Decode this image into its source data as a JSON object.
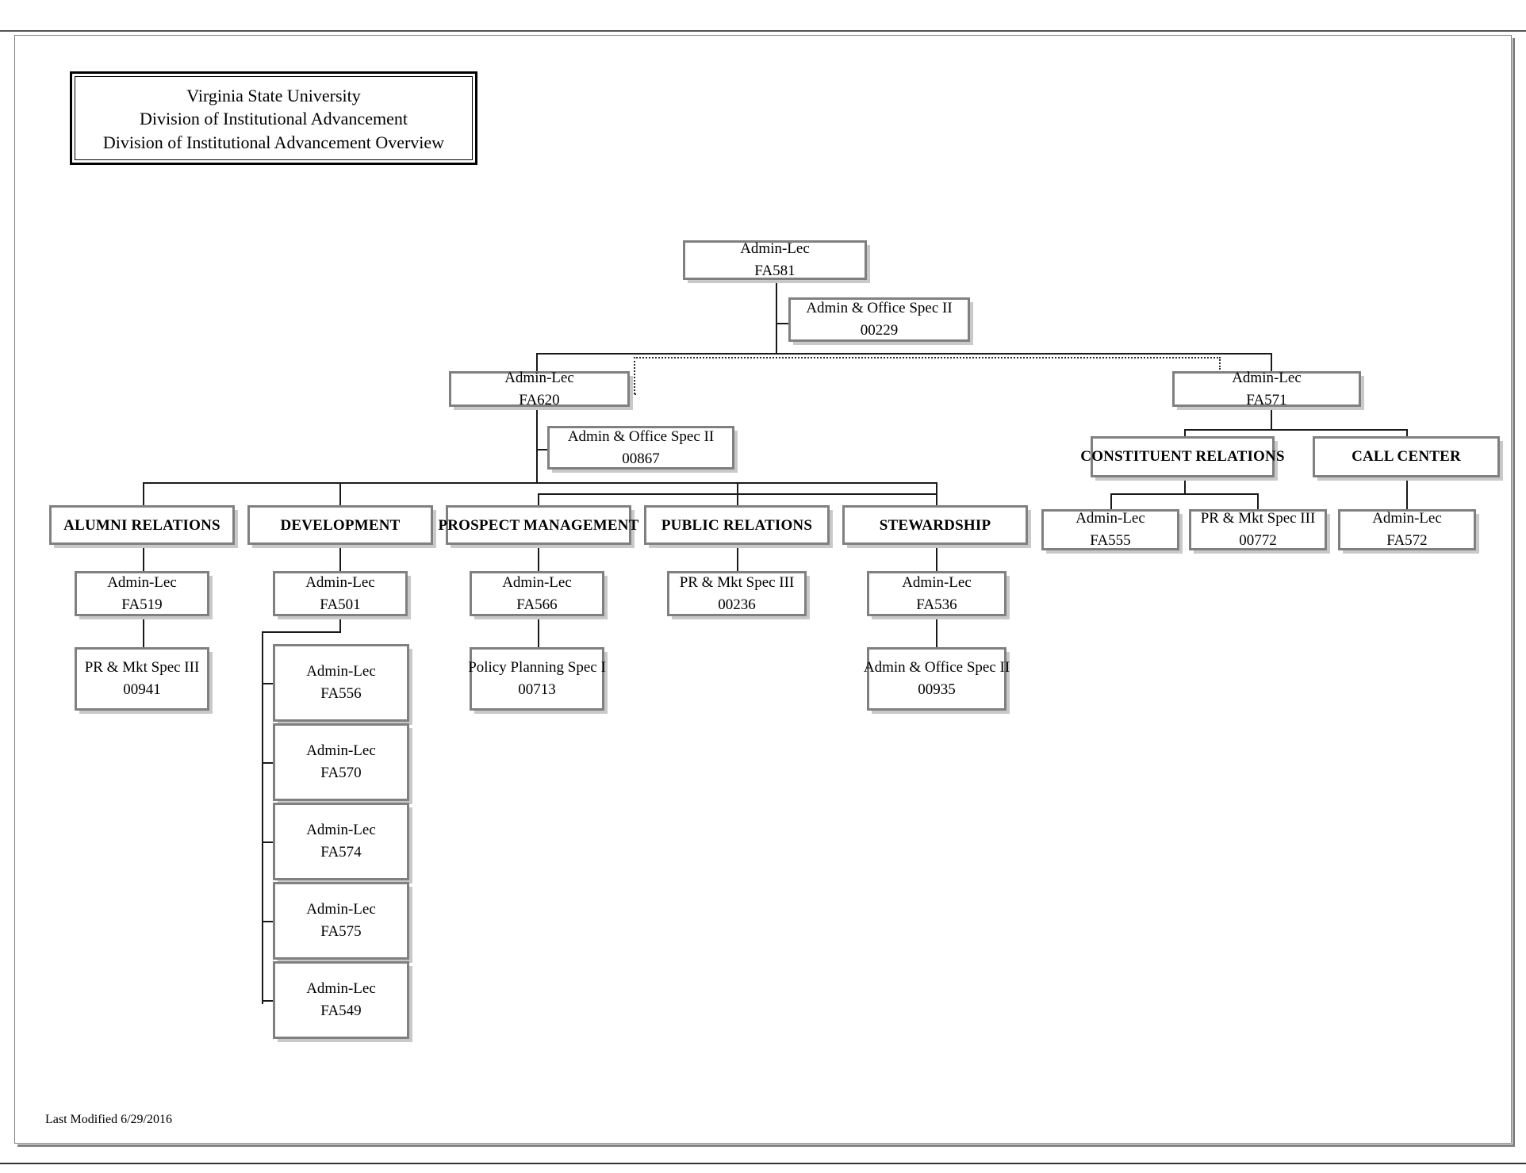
{
  "document": {
    "title_lines": [
      "Virginia State University",
      "Division of Institutional Advancement",
      "Division of Institutional Advancement Overview"
    ],
    "footer": "Last Modified  6/29/2016"
  },
  "chart_data": {
    "type": "diagram",
    "title": "Division of Institutional Advancement Overview",
    "nodes": [
      {
        "id": "n1",
        "role": "Admin-Lec",
        "code": "FA581"
      },
      {
        "id": "n2",
        "role": "Admin & Office Spec II",
        "code": "00229"
      },
      {
        "id": "n3",
        "role": "Admin-Lec",
        "code": "FA620"
      },
      {
        "id": "n4",
        "role": "Admin & Office Spec II",
        "code": "00867"
      },
      {
        "id": "n5",
        "role": "Admin-Lec",
        "code": "FA571"
      },
      {
        "id": "d1",
        "dept": "CONSTITUENT RELATIONS"
      },
      {
        "id": "d2",
        "dept": "CALL CENTER"
      },
      {
        "id": "d3",
        "dept": "ALUMNI RELATIONS"
      },
      {
        "id": "d4",
        "dept": "DEVELOPMENT"
      },
      {
        "id": "d5",
        "dept": "PROSPECT MANAGEMENT"
      },
      {
        "id": "d6",
        "dept": "PUBLIC RELATIONS"
      },
      {
        "id": "d7",
        "dept": "STEWARDSHIP"
      },
      {
        "id": "n6",
        "role": "Admin-Lec",
        "code": "FA555"
      },
      {
        "id": "n7",
        "role": "PR & Mkt Spec III",
        "code": "00772"
      },
      {
        "id": "n8",
        "role": "Admin-Lec",
        "code": "FA572"
      },
      {
        "id": "n9",
        "role": "Admin-Lec",
        "code": "FA519"
      },
      {
        "id": "n10",
        "role": "PR & Mkt Spec III",
        "code": "00941"
      },
      {
        "id": "n11",
        "role": "Admin-Lec",
        "code": "FA501"
      },
      {
        "id": "n12",
        "role": "Admin-Lec",
        "code": "FA556"
      },
      {
        "id": "n13",
        "role": "Admin-Lec",
        "code": "FA570"
      },
      {
        "id": "n14",
        "role": "Admin-Lec",
        "code": "FA574"
      },
      {
        "id": "n15",
        "role": "Admin-Lec",
        "code": "FA575"
      },
      {
        "id": "n16",
        "role": "Admin-Lec",
        "code": "FA549"
      },
      {
        "id": "n17",
        "role": "Admin-Lec",
        "code": "FA566"
      },
      {
        "id": "n18",
        "role": "Policy Planning Spec I",
        "code": "00713"
      },
      {
        "id": "n19",
        "role": "PR & Mkt Spec III",
        "code": "00236"
      },
      {
        "id": "n20",
        "role": "Admin-Lec",
        "code": "FA536"
      },
      {
        "id": "n21",
        "role": "Admin & Office Spec II",
        "code": "00935"
      }
    ],
    "edges": [
      {
        "from": "n1",
        "to": "n2",
        "style": "assistant"
      },
      {
        "from": "n1",
        "to": "n3",
        "style": "solid"
      },
      {
        "from": "n1",
        "to": "n5",
        "style": "solid"
      },
      {
        "from": "n3",
        "to": "n5",
        "style": "dotted"
      },
      {
        "from": "n3",
        "to": "n4",
        "style": "assistant"
      },
      {
        "from": "n3",
        "to": "d3",
        "style": "solid"
      },
      {
        "from": "n3",
        "to": "d4",
        "style": "solid"
      },
      {
        "from": "n3",
        "to": "d5",
        "style": "solid"
      },
      {
        "from": "n3",
        "to": "d6",
        "style": "solid"
      },
      {
        "from": "n3",
        "to": "d7",
        "style": "solid"
      },
      {
        "from": "n5",
        "to": "d1",
        "style": "solid"
      },
      {
        "from": "n5",
        "to": "d2",
        "style": "solid"
      },
      {
        "from": "d1",
        "to": "n6",
        "style": "solid"
      },
      {
        "from": "d1",
        "to": "n7",
        "style": "solid"
      },
      {
        "from": "d2",
        "to": "n8",
        "style": "solid"
      },
      {
        "from": "d3",
        "to": "n9",
        "style": "solid"
      },
      {
        "from": "n9",
        "to": "n10",
        "style": "solid"
      },
      {
        "from": "d4",
        "to": "n11",
        "style": "solid"
      },
      {
        "from": "n11",
        "to": "n12",
        "style": "spine"
      },
      {
        "from": "n11",
        "to": "n13",
        "style": "spine"
      },
      {
        "from": "n11",
        "to": "n14",
        "style": "spine"
      },
      {
        "from": "n11",
        "to": "n15",
        "style": "spine"
      },
      {
        "from": "n11",
        "to": "n16",
        "style": "spine"
      },
      {
        "from": "d5",
        "to": "n17",
        "style": "solid"
      },
      {
        "from": "n17",
        "to": "n18",
        "style": "solid"
      },
      {
        "from": "d6",
        "to": "n19",
        "style": "solid"
      },
      {
        "from": "d7",
        "to": "n20",
        "style": "solid"
      },
      {
        "from": "n20",
        "to": "n21",
        "style": "solid"
      }
    ],
    "colors": {
      "box_border": "#808080",
      "box_fill": "#ffffff",
      "line": "#1a1a1a",
      "text": "#000000"
    }
  }
}
